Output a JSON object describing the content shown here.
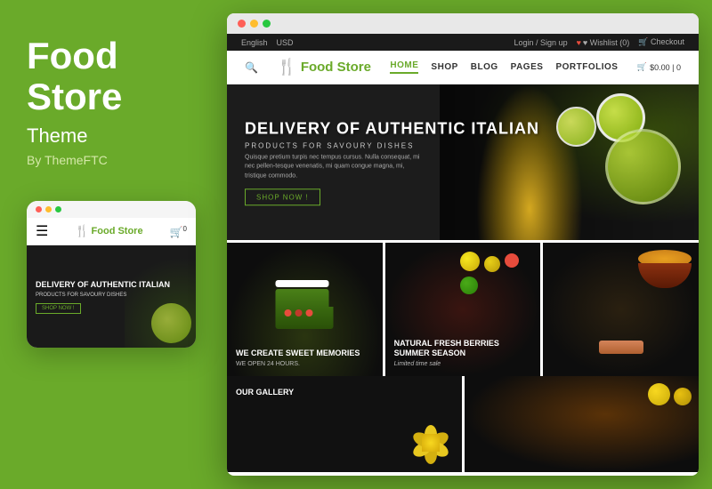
{
  "leftPanel": {
    "titleLine1": "Food",
    "titleLine2": "Store",
    "subtitle": "Theme",
    "by": "By ThemeFTC"
  },
  "mobileNav": {
    "logo": "Food Store",
    "chefIcon": "🍴",
    "cartIcon": "🛒",
    "cartCount": "0",
    "menuIcon": "☰"
  },
  "mobileHero": {
    "heading": "DELIVERY OF AUTHENTIC ITALIAN",
    "sub": "PRODUCTS FOR SAVOURY DISHES",
    "btn": "SHOP NOW !"
  },
  "browserDots": [
    "red",
    "yellow",
    "green"
  ],
  "topbar": {
    "language": "English",
    "currency": "USD",
    "login": "Login / Sign up",
    "wishlist": "♥ Wishlist (0)",
    "checkout": "🛒 Checkout"
  },
  "header": {
    "logo": "Food Store",
    "chefIcon": "👨‍🍳",
    "navItems": [
      "HOME",
      "SHOP",
      "BLOG",
      "PAGES",
      "PORTFOLIOS"
    ],
    "activeNav": "HOME",
    "cartTotal": "$0.00 | 0"
  },
  "hero": {
    "heading": "DELIVERY OF AUTHENTIC ITALIAN",
    "subheading": "PRODUCTS FOR SAVOURY DISHES",
    "description": "Quisque pretium turpis nec tempus cursus. Nulla consequat, mi nec pellen-tesque venenatis, mi quam congue magna, mi, tristique commodo.",
    "shopBtn": "SHOP NOW !"
  },
  "gridCards": [
    {
      "heading": "WE CREATE SWEET MEMORIES",
      "sub": "WE OPEN 24 HOURS."
    },
    {
      "heading": "NATURAL FRESH BERRIES SUMMER SEASON",
      "sub": "Limited time sale"
    },
    {
      "heading": "",
      "sub": ""
    }
  ],
  "gallerySection": {
    "label": "OUR GALLERY"
  },
  "colors": {
    "green": "#6aaa2a",
    "dark": "#1c1c1c",
    "white": "#ffffff"
  }
}
